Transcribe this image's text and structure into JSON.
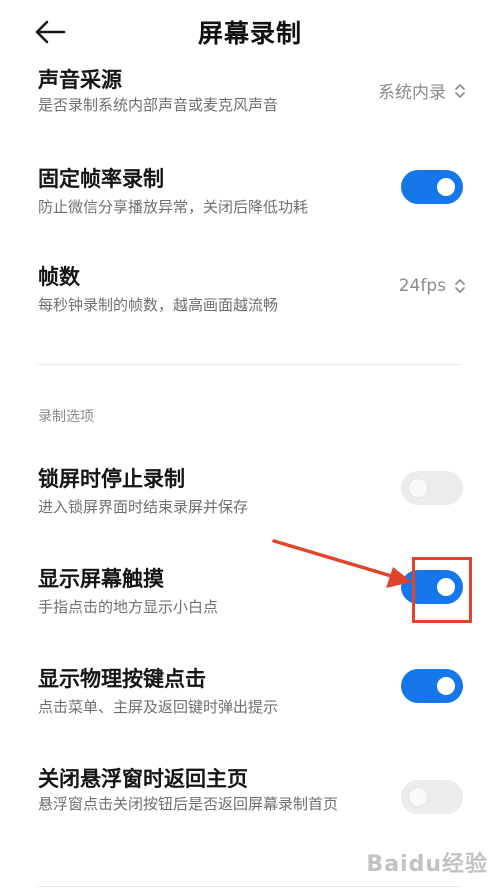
{
  "header": {
    "title": "屏幕录制"
  },
  "audio_source": {
    "title": "声音采源",
    "subtitle": "是否录制系统内部声音或麦克风声音",
    "value": "系统内录"
  },
  "fixed_fps": {
    "title": "固定帧率录制",
    "subtitle": "防止微信分享播放异常，关闭后降低功耗",
    "enabled": true
  },
  "fps": {
    "title": "帧数",
    "subtitle": "每秒钟录制的帧数，越高画面越流畅",
    "value": "24fps"
  },
  "section_label": "录制选项",
  "options": [
    {
      "title": "锁屏时停止录制",
      "subtitle": "进入锁屏界面时结束录屏并保存",
      "enabled": false
    },
    {
      "title": "显示屏幕触摸",
      "subtitle": "手指点击的地方显示小白点",
      "enabled": true
    },
    {
      "title": "显示物理按键点击",
      "subtitle": "点击菜单、主屏及返回键时弹出提示",
      "enabled": true
    },
    {
      "title": "关闭悬浮窗时返回主页",
      "subtitle": "悬浮窗点击关闭按钮后是否返回屏幕录制首页",
      "enabled": false
    }
  ],
  "colors": {
    "toggle_on": "#1577ea",
    "toggle_off": "#ececec",
    "annotation": "#e0452c"
  },
  "watermark": "Baidu经验"
}
